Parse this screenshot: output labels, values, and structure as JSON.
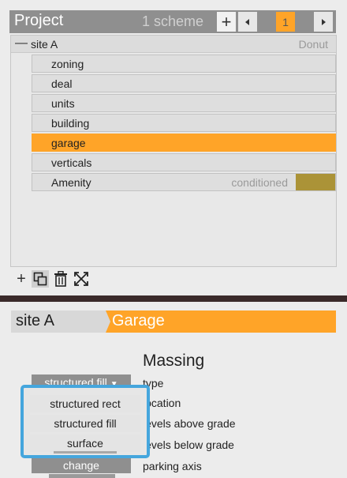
{
  "project": {
    "title": "Project",
    "scheme_count": "1 scheme",
    "add_label": "+",
    "page_number": "1",
    "prev_label": "◀",
    "next_label": "▶"
  },
  "tree": {
    "site": {
      "toggle": "—",
      "name": "site A",
      "kind": "Donut"
    },
    "items": [
      {
        "label": "zoning"
      },
      {
        "label": "deal"
      },
      {
        "label": "units"
      },
      {
        "label": "building"
      },
      {
        "label": "garage",
        "selected": true
      },
      {
        "label": "verticals"
      },
      {
        "label": "Amenity",
        "status": "conditioned",
        "swatch_color": "#ab9337"
      }
    ]
  },
  "tree_toolbar": {
    "icons": [
      "add-icon",
      "duplicate-icon",
      "trash-icon",
      "expand-icon"
    ],
    "add_label": "+"
  },
  "detail": {
    "breadcrumb": {
      "site": "site A",
      "section": "Garage"
    },
    "heading": "Massing",
    "type_value": "structured fill",
    "props": [
      "type",
      "location",
      "levels above grade",
      "levels below grade",
      "parking axis"
    ],
    "change_label": "change"
  },
  "dropdown": {
    "options": [
      "structured rect",
      "structured fill",
      "surface"
    ],
    "highlight_color": "#45a6dd"
  },
  "colors": {
    "accent": "#ffa428",
    "titlebar": "#8f8f8f",
    "background": "#ececec"
  }
}
